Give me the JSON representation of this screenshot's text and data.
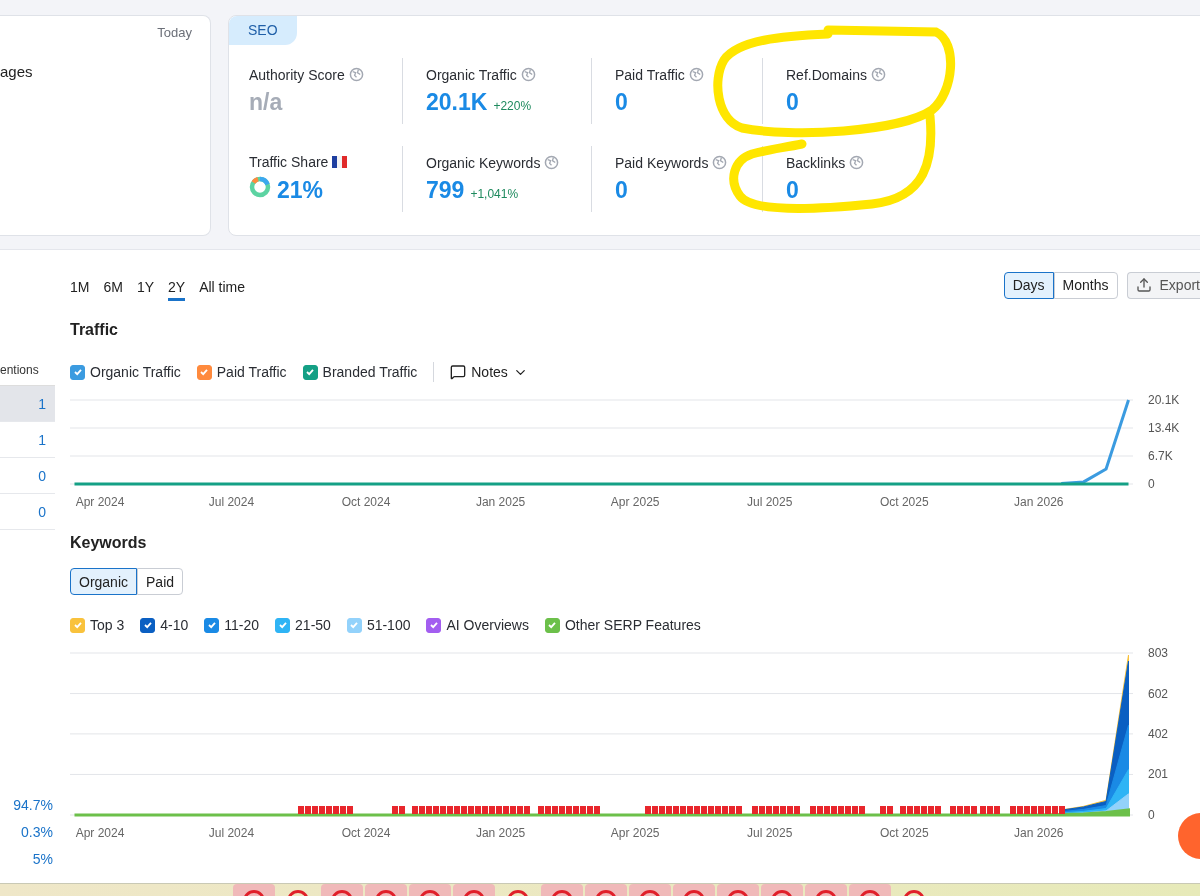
{
  "overview_card": {
    "date_label": "Today",
    "text": "ages"
  },
  "seo_card": {
    "tab": "SEO",
    "metrics": [
      {
        "label": "Authority Score",
        "kind": "plain",
        "value": "n/a",
        "muted": true
      },
      {
        "label": "Organic Traffic",
        "kind": "plain",
        "value": "20.1K",
        "muted": false,
        "change": "+220%"
      },
      {
        "label": "Paid Traffic",
        "kind": "plain",
        "value": "0",
        "muted": false
      },
      {
        "label": "Ref.Domains",
        "kind": "plain",
        "value": "0",
        "muted": false
      },
      {
        "label": "Traffic Share",
        "kind": "share",
        "value": "21%",
        "muted": false
      },
      {
        "label": "Organic Keywords",
        "kind": "plain",
        "value": "799",
        "muted": false,
        "change": "+1,041%"
      },
      {
        "label": "Paid Keywords",
        "kind": "plain",
        "value": "0",
        "muted": false
      },
      {
        "label": "Backlinks",
        "kind": "plain",
        "value": "0",
        "muted": false
      }
    ]
  },
  "mentions_column": {
    "header": "entions",
    "rows": [
      {
        "value": "1",
        "selected": true
      },
      {
        "value": "1",
        "selected": false
      },
      {
        "value": "0",
        "selected": false
      },
      {
        "value": "0",
        "selected": false
      }
    ],
    "percentages": [
      "94.7%",
      "0.3%",
      "5%"
    ]
  },
  "period_tabs": [
    {
      "label": "1M",
      "selected": false
    },
    {
      "label": "6M",
      "selected": false
    },
    {
      "label": "1Y",
      "selected": false
    },
    {
      "label": "2Y",
      "selected": true
    },
    {
      "label": "All time",
      "selected": false
    }
  ],
  "granularity": [
    {
      "label": "Days",
      "selected": true
    },
    {
      "label": "Months",
      "selected": false
    }
  ],
  "export_button": {
    "label": "Export"
  },
  "traffic": {
    "title": "Traffic",
    "legend": [
      {
        "checked": true
      },
      {
        "checked": true
      },
      {
        "checked": true
      }
    ],
    "notes": {
      "label": "Notes"
    },
    "chart_data": {
      "type": "line",
      "grid": true,
      "categories": [
        null,
        "Apr 2024",
        null,
        null,
        null,
        null,
        null,
        "Jul 2024",
        null,
        null,
        null,
        null,
        null,
        "Oct 2024",
        null,
        null,
        null,
        null,
        null,
        "Jan 2025",
        null,
        null,
        null,
        null,
        null,
        "Apr 2025",
        null,
        null,
        null,
        null,
        null,
        "Jul 2025",
        null,
        null,
        null,
        null,
        null,
        "Oct 2025",
        null,
        null,
        null,
        null,
        null,
        "Jan 2026",
        null,
        null,
        null,
        null
      ],
      "series": [
        {
          "name": "Organic Traffic",
          "color": "#3b9be0",
          "values": [
            null,
            null,
            null,
            null,
            null,
            null,
            null,
            null,
            null,
            null,
            null,
            null,
            null,
            null,
            null,
            null,
            null,
            null,
            null,
            null,
            null,
            null,
            null,
            null,
            null,
            null,
            null,
            null,
            null,
            null,
            null,
            null,
            null,
            null,
            null,
            null,
            null,
            null,
            null,
            null,
            null,
            null,
            null,
            null,
            150,
            500,
            3600,
            20100
          ]
        },
        {
          "name": "Paid Traffic",
          "color": "#ff8a3d",
          "values": [
            null,
            null,
            null,
            null,
            null,
            null,
            null,
            null,
            null,
            null,
            null,
            null,
            null,
            null,
            null,
            null,
            null,
            null,
            null,
            null,
            null,
            null,
            null,
            null,
            null,
            null,
            null,
            null,
            null,
            null,
            null,
            null,
            null,
            null,
            null,
            null,
            null,
            null,
            null,
            null,
            null,
            null,
            null,
            null,
            null,
            null,
            null,
            null
          ]
        },
        {
          "name": "Branded Traffic",
          "color": "#14a085",
          "values": [
            0,
            0,
            0,
            0,
            0,
            0,
            0,
            0,
            0,
            0,
            0,
            0,
            0,
            0,
            0,
            0,
            0,
            0,
            0,
            0,
            0,
            0,
            0,
            0,
            0,
            0,
            0,
            0,
            0,
            0,
            0,
            0,
            0,
            0,
            0,
            0,
            0,
            0,
            0,
            0,
            0,
            0,
            0,
            0,
            0,
            0,
            0,
            0
          ]
        }
      ],
      "ylim": [
        0,
        20100
      ],
      "yticks": [
        {
          "value": 0,
          "label": "0"
        },
        {
          "value": 6700,
          "label": "6.7K"
        },
        {
          "value": 13400,
          "label": "13.4K"
        },
        {
          "value": 20100,
          "label": "20.1K"
        }
      ]
    }
  },
  "keywords": {
    "title": "Keywords",
    "tabs": [
      {
        "label": "Organic",
        "selected": true
      },
      {
        "label": "Paid",
        "selected": false
      }
    ],
    "legend": [
      {
        "checked": true
      },
      {
        "checked": true
      },
      {
        "checked": true
      },
      {
        "checked": true
      },
      {
        "checked": true
      },
      {
        "checked": true
      },
      {
        "checked": true
      }
    ],
    "chart_data": {
      "type": "area",
      "grid": true,
      "categories": [
        null,
        "Apr 2024",
        null,
        null,
        null,
        null,
        null,
        "Jul 2024",
        null,
        null,
        null,
        null,
        null,
        "Oct 2024",
        null,
        null,
        null,
        null,
        null,
        "Jan 2025",
        null,
        null,
        null,
        null,
        null,
        "Apr 2025",
        null,
        null,
        null,
        null,
        null,
        "Jul 2025",
        null,
        null,
        null,
        null,
        null,
        "Oct 2025",
        null,
        null,
        null,
        null,
        null,
        "Jan 2026",
        null,
        null,
        null,
        null
      ],
      "series": [
        {
          "name": "Top 3",
          "color": "#f9c23c",
          "values": [
            null,
            null,
            null,
            null,
            null,
            null,
            null,
            null,
            null,
            null,
            null,
            null,
            null,
            null,
            null,
            null,
            null,
            null,
            null,
            null,
            null,
            null,
            null,
            null,
            null,
            null,
            null,
            null,
            null,
            null,
            null,
            null,
            null,
            null,
            null,
            null,
            null,
            null,
            null,
            null,
            null,
            null,
            null,
            null,
            25,
            43,
            73,
            793
          ]
        },
        {
          "name": "4-10",
          "color": "#0a5fc2",
          "values": [
            null,
            null,
            null,
            null,
            null,
            null,
            null,
            null,
            null,
            null,
            null,
            null,
            null,
            null,
            null,
            null,
            null,
            null,
            null,
            null,
            null,
            null,
            null,
            null,
            null,
            null,
            null,
            null,
            null,
            null,
            null,
            null,
            null,
            null,
            null,
            null,
            null,
            null,
            null,
            null,
            null,
            null,
            null,
            null,
            24,
            40,
            67,
            763
          ]
        },
        {
          "name": "11-20",
          "color": "#1a8ae5",
          "values": [
            null,
            null,
            null,
            null,
            null,
            null,
            null,
            null,
            null,
            null,
            null,
            null,
            null,
            null,
            null,
            null,
            null,
            null,
            null,
            null,
            null,
            null,
            null,
            null,
            null,
            null,
            null,
            null,
            null,
            null,
            null,
            null,
            null,
            null,
            null,
            null,
            null,
            null,
            null,
            null,
            null,
            null,
            null,
            null,
            16,
            28,
            47,
            445
          ]
        },
        {
          "name": "21-50",
          "color": "#2fb4f5",
          "values": [
            null,
            null,
            null,
            null,
            null,
            null,
            null,
            null,
            null,
            null,
            null,
            null,
            null,
            null,
            null,
            null,
            null,
            null,
            null,
            null,
            null,
            null,
            null,
            null,
            null,
            null,
            null,
            null,
            null,
            null,
            null,
            null,
            null,
            null,
            null,
            null,
            null,
            null,
            null,
            null,
            null,
            null,
            null,
            null,
            10,
            18,
            32,
            225
          ]
        },
        {
          "name": "51-100",
          "color": "#93d2fb",
          "values": [
            null,
            null,
            null,
            null,
            null,
            null,
            null,
            null,
            null,
            null,
            null,
            null,
            null,
            null,
            null,
            null,
            null,
            null,
            null,
            null,
            null,
            null,
            null,
            null,
            null,
            null,
            null,
            null,
            null,
            null,
            null,
            null,
            null,
            null,
            null,
            null,
            null,
            null,
            null,
            null,
            null,
            null,
            null,
            null,
            5,
            10,
            20,
            105
          ]
        },
        {
          "name": "AI Overviews",
          "color": "#a35ef0",
          "values": [
            null,
            null,
            null,
            null,
            null,
            null,
            null,
            null,
            null,
            null,
            null,
            null,
            null,
            null,
            null,
            null,
            null,
            null,
            null,
            null,
            null,
            null,
            null,
            null,
            null,
            null,
            null,
            null,
            null,
            null,
            null,
            null,
            null,
            null,
            null,
            null,
            null,
            null,
            null,
            null,
            null,
            null,
            null,
            null,
            null,
            null,
            null,
            null
          ]
        },
        {
          "name": "Other SERP Features",
          "color": "#6cc04a",
          "values": [
            0,
            0,
            0,
            0,
            0,
            0,
            0,
            0,
            0,
            0,
            0,
            0,
            0,
            0,
            0,
            0,
            0,
            0,
            0,
            0,
            0,
            0,
            0,
            0,
            0,
            0,
            0,
            0,
            0,
            0,
            0,
            0,
            0,
            0,
            0,
            0,
            0,
            0,
            0,
            0,
            0,
            0,
            0,
            0,
            2,
            5,
            12,
            25
          ]
        }
      ],
      "ylim": [
        0,
        803
      ],
      "yticks": [
        0,
        201,
        402,
        602,
        803
      ]
    }
  }
}
